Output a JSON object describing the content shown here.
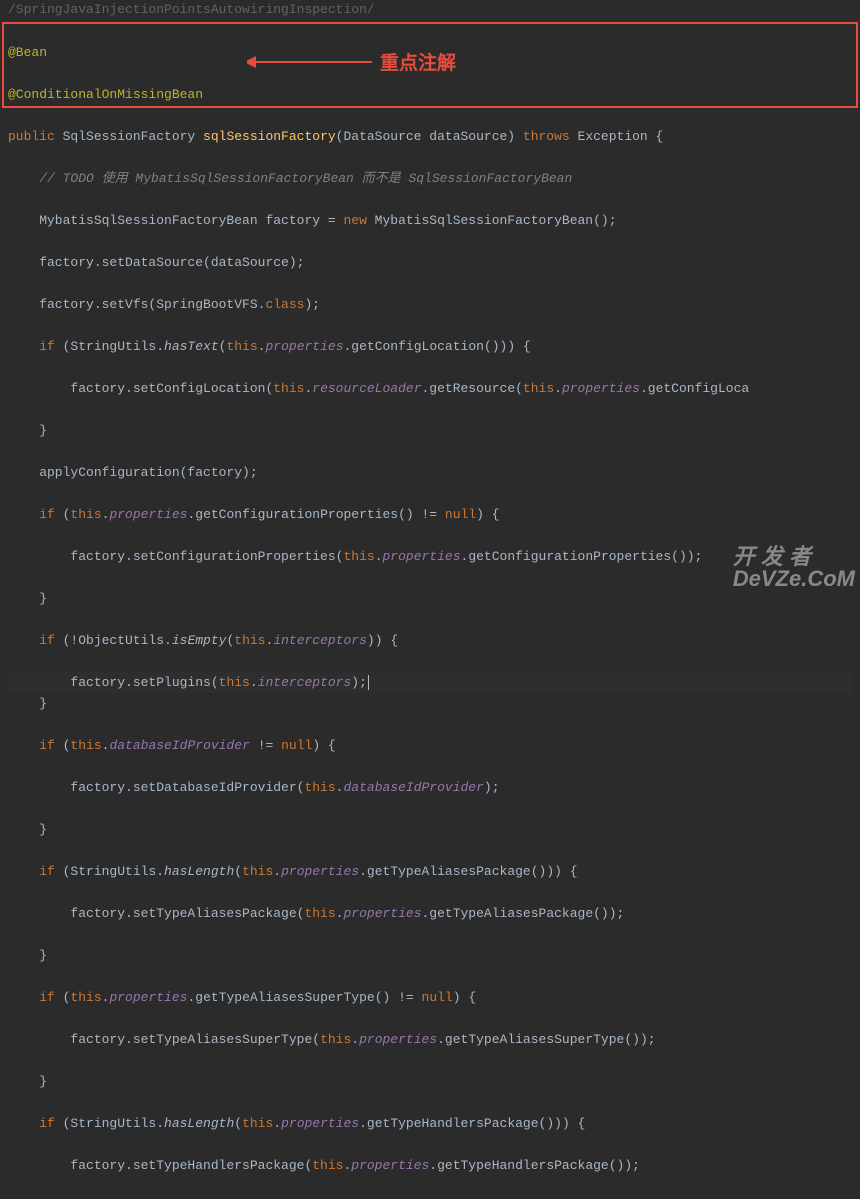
{
  "breadcrumb": "/SpringJavaInjectionPointsAutowiringInspection/",
  "annotation_label": "重点注解",
  "watermark_line1": "开 发 者",
  "watermark_line2": "DeVZe.CoM",
  "code": {
    "l1_ann1": "@Bean",
    "l2_ann2": "@ConditionalOnMissingBean",
    "l3_kw_public": "public",
    "l3_type": " SqlSessionFactory ",
    "l3_method": "sqlSessionFactory",
    "l3_args": "(DataSource dataSource) ",
    "l3_kw_throws": "throws",
    "l3_exc": " Exception {",
    "l4": "    // TODO 使用 MybatisSqlSessionFactoryBean 而不是 SqlSessionFactoryBean",
    "l5_a": "    MybatisSqlSessionFactoryBean factory = ",
    "l5_new": "new",
    "l5_b": " MybatisSqlSessionFactoryBean();",
    "l6": "    factory.setDataSource(dataSource);",
    "l7_a": "    factory.setVfs(SpringBootVFS.",
    "l7_kw": "class",
    "l7_b": ");",
    "l8_if": "    if",
    "l8_a": " (StringUtils.",
    "l8_m": "hasText",
    "l8_b": "(",
    "l8_this": "this",
    "l8_c": ".",
    "l8_prop": "properties",
    "l8_d": ".getConfigLocation())) {",
    "l9_a": "        factory.setConfigLocation(",
    "l9_this": "this",
    "l9_b": ".",
    "l9_prop": "resourceLoader",
    "l9_c": ".getResource(",
    "l9_this2": "this",
    "l9_d": ".",
    "l9_prop2": "properties",
    "l9_e": ".getConfigLoca",
    "l10": "    }",
    "l11": "    applyConfiguration(factory);",
    "l12_if": "    if",
    "l12_a": " (",
    "l12_this": "this",
    "l12_b": ".",
    "l12_prop": "properties",
    "l12_c": ".getConfigurationProperties() != ",
    "l12_null": "null",
    "l12_d": ") {",
    "l13_a": "        factory.setConfigurationProperties(",
    "l13_this": "this",
    "l13_b": ".",
    "l13_prop": "properties",
    "l13_c": ".getConfigurationProperties());",
    "l14": "    }",
    "l15_if": "    if",
    "l15_a": " (!ObjectUtils.",
    "l15_m": "isEmpty",
    "l15_b": "(",
    "l15_this": "this",
    "l15_c": ".",
    "l15_prop": "interceptors",
    "l15_d": ")) {",
    "l16_a": "        factory.setPlugins(",
    "l16_this": "this",
    "l16_b": ".",
    "l16_prop": "interceptors",
    "l16_c": ");",
    "l17": "    }",
    "l18_if": "    if",
    "l18_a": " (",
    "l18_this": "this",
    "l18_b": ".",
    "l18_prop": "databaseIdProvider",
    "l18_c": " != ",
    "l18_null": "null",
    "l18_d": ") {",
    "l19_a": "        factory.setDatabaseIdProvider(",
    "l19_this": "this",
    "l19_b": ".",
    "l19_prop": "databaseIdProvider",
    "l19_c": ");",
    "l20": "    }",
    "l21_if": "    if",
    "l21_a": " (StringUtils.",
    "l21_m": "hasLength",
    "l21_b": "(",
    "l21_this": "this",
    "l21_c": ".",
    "l21_prop": "properties",
    "l21_d": ".getTypeAliasesPackage())) {",
    "l22_a": "        factory.setTypeAliasesPackage(",
    "l22_this": "this",
    "l22_b": ".",
    "l22_prop": "properties",
    "l22_c": ".getTypeAliasesPackage());",
    "l23": "    }",
    "l24_if": "    if",
    "l24_a": " (",
    "l24_this": "this",
    "l24_b": ".",
    "l24_prop": "properties",
    "l24_c": ".getTypeAliasesSuperType() != ",
    "l24_null": "null",
    "l24_d": ") {",
    "l25_a": "        factory.setTypeAliasesSuperType(",
    "l25_this": "this",
    "l25_b": ".",
    "l25_prop": "properties",
    "l25_c": ".getTypeAliasesSuperType());",
    "l26": "    }",
    "l27_if": "    if",
    "l27_a": " (StringUtils.",
    "l27_m": "hasLength",
    "l27_b": "(",
    "l27_this": "this",
    "l27_c": ".",
    "l27_prop": "properties",
    "l27_d": ".getTypeHandlersPackage())) {",
    "l28_a": "        factory.setTypeHandlersPackage(",
    "l28_this": "this",
    "l28_b": ".",
    "l28_prop": "properties",
    "l28_c": ".getTypeHandlersPackage());"
  }
}
